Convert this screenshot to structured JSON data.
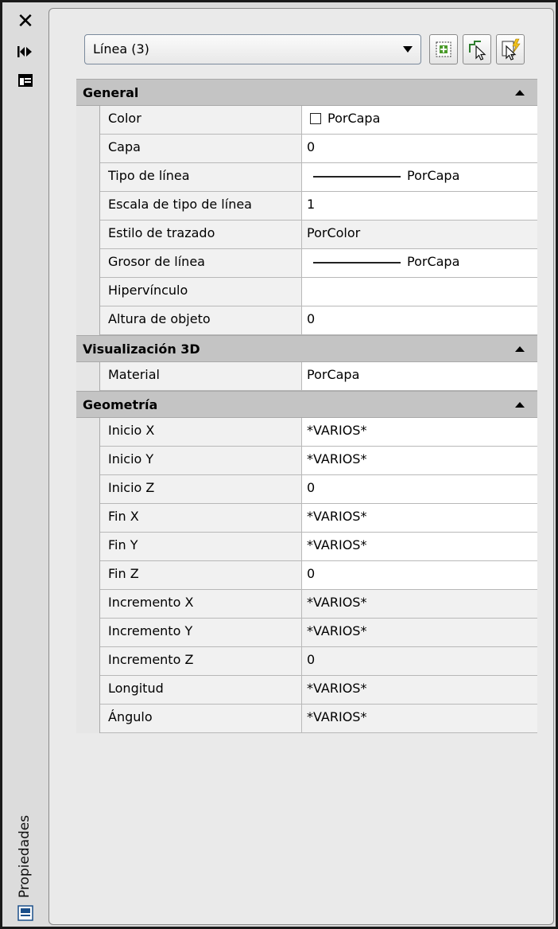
{
  "window": {
    "vertical_title": "Propiedades"
  },
  "toolbar": {
    "selection_label": "Línea (3)"
  },
  "sections": [
    {
      "title": "General",
      "rows": [
        {
          "name": "Color",
          "value": "PorCapa"
        },
        {
          "name": "Capa",
          "value": "0"
        },
        {
          "name": "Tipo de línea",
          "value": "PorCapa"
        },
        {
          "name": "Escala de tipo de línea",
          "value": "1"
        },
        {
          "name": "Estilo de trazado",
          "value": "PorColor"
        },
        {
          "name": "Grosor de línea",
          "value": "PorCapa"
        },
        {
          "name": "Hipervínculo",
          "value": ""
        },
        {
          "name": "Altura de objeto",
          "value": "0"
        }
      ]
    },
    {
      "title": "Visualización 3D",
      "rows": [
        {
          "name": "Material",
          "value": "PorCapa"
        }
      ]
    },
    {
      "title": "Geometría",
      "rows": [
        {
          "name": "Inicio X",
          "value": "*VARIOS*"
        },
        {
          "name": "Inicio Y",
          "value": "*VARIOS*"
        },
        {
          "name": "Inicio Z",
          "value": "0"
        },
        {
          "name": "Fin X",
          "value": "*VARIOS*"
        },
        {
          "name": "Fin Y",
          "value": "*VARIOS*"
        },
        {
          "name": "Fin Z",
          "value": "0"
        },
        {
          "name": "Incremento X",
          "value": "*VARIOS*"
        },
        {
          "name": "Incremento Y",
          "value": "*VARIOS*"
        },
        {
          "name": "Incremento Z",
          "value": "0"
        },
        {
          "name": "Longitud",
          "value": "*VARIOS*"
        },
        {
          "name": "Ángulo",
          "value": "*VARIOS*"
        }
      ]
    }
  ],
  "colors": {
    "section_header": "#c4c4c4",
    "panel_bg": "#eaeaea",
    "readonly_cell": "#f1f1f1"
  }
}
